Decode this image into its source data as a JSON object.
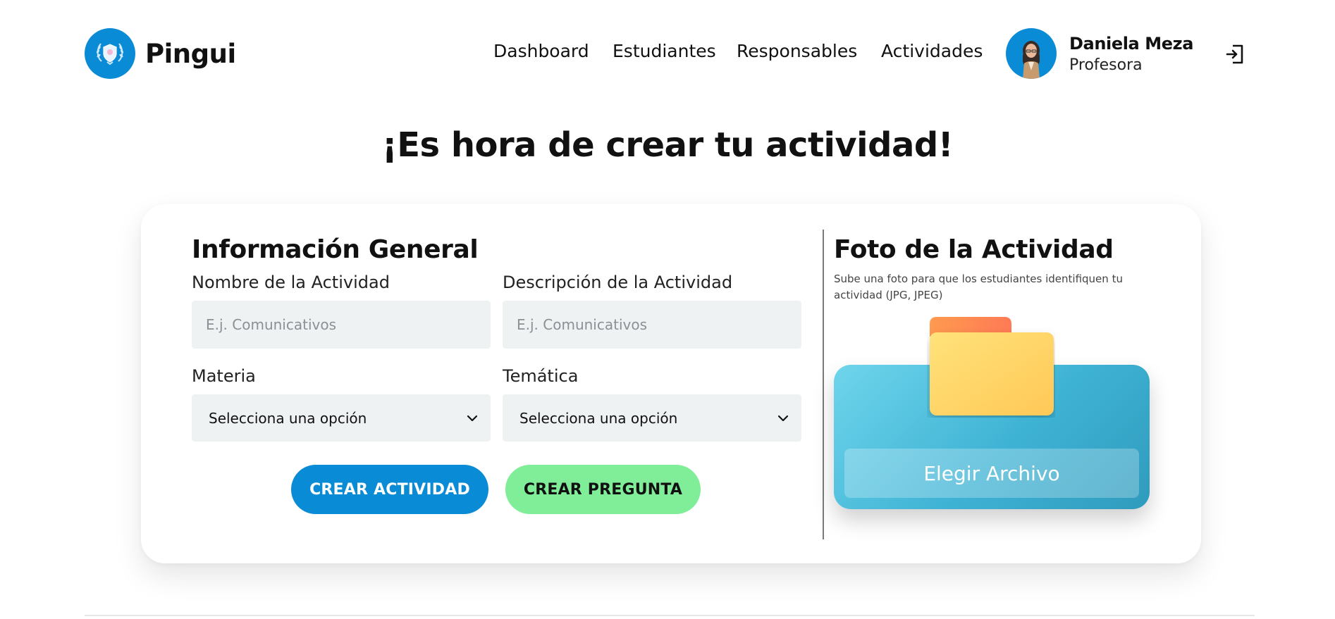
{
  "brand": {
    "name": "Pingui"
  },
  "nav": {
    "items": [
      {
        "label": "Dashboard"
      },
      {
        "label": "Estudiantes"
      },
      {
        "label": "Responsables"
      },
      {
        "label": "Actividades"
      }
    ]
  },
  "user": {
    "name": "Daniela Meza",
    "role": "Profesora"
  },
  "page": {
    "title": "¡Es hora de crear tu actividad!"
  },
  "form": {
    "section_title": "Información General",
    "fields": {
      "nombre": {
        "label": "Nombre de la Actividad",
        "placeholder": "E.j. Comunicativos"
      },
      "descripcion": {
        "label": "Descripción de la Actividad",
        "placeholder": "E.j. Comunicativos"
      },
      "materia": {
        "label": "Materia",
        "selected": "Selecciona una opción"
      },
      "tematica": {
        "label": "Temática",
        "selected": "Selecciona una opción"
      }
    },
    "buttons": {
      "crear_actividad": "CREAR ACTIVIDAD",
      "crear_pregunta": "CREAR PREGUNTA"
    }
  },
  "photo": {
    "title": "Foto de la Actividad",
    "subtitle": "Sube una foto para que los estudiantes identifiquen tu actividad (JPG, JPEG)",
    "upload_label": "Elegir Archivo"
  },
  "colors": {
    "primary": "#0a8bd6",
    "secondary": "#80ee98",
    "input_bg": "#eff2f3",
    "upload_gradient_start": "#6fd5ec",
    "upload_gradient_end": "#2f9bbd",
    "folder_body": "#ffd667",
    "folder_tab": "#ff8a55"
  },
  "icons": {
    "logo": "shield-laurel-icon",
    "avatar": "user-avatar",
    "logout": "logout-icon",
    "select_arrow": "chevron-down-icon",
    "folder": "folder-icon"
  }
}
